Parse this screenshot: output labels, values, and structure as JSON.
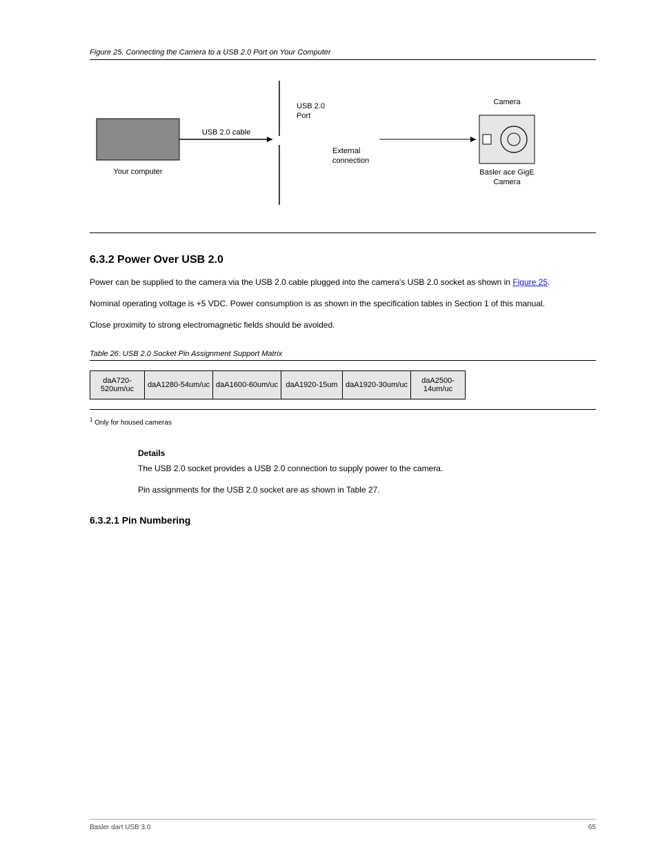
{
  "figure25": {
    "caption": "Figure 25. Connecting the Camera to a USB 2.0 Port on Your Computer",
    "box_label": "Your computer",
    "cable_label": "USB 2.0 cable",
    "port_caption_1": "USB 2.0",
    "port_caption_2": "Port",
    "ext_conn_caption_1": "External",
    "ext_conn_caption_2": "connection",
    "ace_caption_1": "Basler ace GigE",
    "ace_caption_2": "Camera",
    "camera_word": "Camera"
  },
  "section": {
    "title": "6.3.2 Power Over USB 2.0",
    "para1_prefix": "Power can be supplied to the camera via the USB 2.0 cable plugged into the camera's USB 2.0 socket as shown in ",
    "para1_link": "Figure 25",
    "para1_suffix": ".",
    "para2": "Nominal operating voltage is +5 VDC. Power consumption is as shown in the specification tables in Section 1 of this manual.",
    "para3": "Close proximity to strong electromagnetic fields should be avoided."
  },
  "table": {
    "caption": "Table 26: USB 2.0 Socket Pin Assignment Support Matrix",
    "headers": [
      "daA720-520um/uc",
      "daA1280-54um/uc",
      "daA1600-60um/uc",
      "daA1920-15um",
      "daA1920-30um/uc",
      "daA2500-14um/uc"
    ],
    "widths": [
      70,
      90,
      90,
      80,
      90,
      70
    ],
    "footnote_marker": "1",
    "footnote_text": "Only for housed cameras"
  },
  "details": {
    "title": "Details",
    "para_a": "The USB 2.0 socket provides a USB 2.0 connection to supply power to the camera.",
    "para_b_prefix": "Pin assignments for the USB 2.0 socket are as shown in ",
    "para_b_link": "Table 27",
    "para_b_suffix": "."
  },
  "subheading": "6.3.2.1 Pin Numbering",
  "footer": {
    "doc_id": "Basler dart USB 3.0",
    "page": "65"
  }
}
